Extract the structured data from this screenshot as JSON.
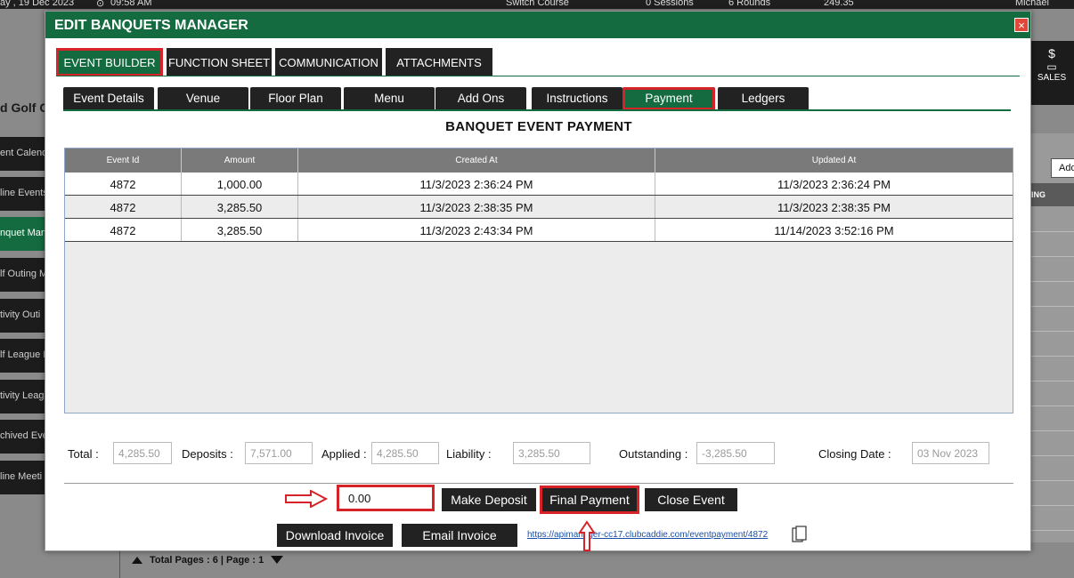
{
  "background": {
    "topbar": {
      "date": "ay , 19 Dec 2023",
      "time": "09:58 AM",
      "switch_course": "Switch Course",
      "sessions": "0 Sessions",
      "rounds": "6 Rounds",
      "amount": "249.35",
      "user": "Michael"
    },
    "page_title": "d Golf C",
    "sidebar": [
      {
        "label": "ent Calend",
        "active": false
      },
      {
        "label": "line Events",
        "active": false
      },
      {
        "label": "nquet Man",
        "active": true
      },
      {
        "label": "lf Outing M",
        "active": false
      },
      {
        "label": "tivity Outi",
        "active": false
      },
      {
        "label": "lf League N",
        "active": false
      },
      {
        "label": "tivity Leag",
        "active": false
      },
      {
        "label": "chived Eve",
        "active": false
      },
      {
        "label": "line Meeti",
        "active": false
      }
    ],
    "sales_label": "SALES",
    "add_label": "Add",
    "column_label": "ING",
    "pagination": "Total Pages : 6 | Page : 1"
  },
  "modal": {
    "title": "EDIT BANQUETS MANAGER",
    "close_glyph": "×",
    "main_tabs": [
      {
        "label": "EVENT BUILDER",
        "active": true
      },
      {
        "label": "FUNCTION SHEET",
        "active": false
      },
      {
        "label": "COMMUNICATION",
        "active": false
      },
      {
        "label": "ATTACHMENTS",
        "active": false
      }
    ],
    "sub_tabs": [
      {
        "label": "Event Details",
        "active": false
      },
      {
        "label": "Venue",
        "active": false
      },
      {
        "label": "Floor Plan",
        "active": false
      },
      {
        "label": "Menu",
        "active": false
      },
      {
        "label": "Add Ons",
        "active": false
      },
      {
        "label": "Instructions",
        "active": false
      },
      {
        "label": "Payment",
        "active": true
      },
      {
        "label": "Ledgers",
        "active": false
      }
    ],
    "section_title": "BANQUET EVENT PAYMENT",
    "table": {
      "columns": [
        "Event Id",
        "Amount",
        "Created At",
        "Updated At"
      ],
      "rows": [
        [
          "4872",
          "1,000.00",
          "11/3/2023 2:36:24 PM",
          "11/3/2023 2:36:24 PM"
        ],
        [
          "4872",
          "3,285.50",
          "11/3/2023 2:38:35 PM",
          "11/3/2023 2:38:35 PM"
        ],
        [
          "4872",
          "3,285.50",
          "11/3/2023 2:43:34 PM",
          "11/14/2023 3:52:16 PM"
        ]
      ]
    },
    "totals": {
      "total_label": "Total :",
      "total_value": "4,285.50",
      "deposits_label": "Deposits :",
      "deposits_value": "7,571.00",
      "applied_label": "Applied :",
      "applied_value": "4,285.50",
      "liability_label": "Liability :",
      "liability_value": "3,285.50",
      "outstanding_label": "Outstanding :",
      "outstanding_value": "-3,285.50",
      "closing_label": "Closing Date :",
      "closing_value": "03 Nov 2023"
    },
    "amount_input_value": "0.00",
    "buttons": {
      "make_deposit": "Make Deposit",
      "final_payment": "Final Payment",
      "close_event": "Close Event",
      "download_invoice": "Download Invoice",
      "email_invoice": "Email Invoice"
    },
    "payment_link": "https://apimanager-cc17.clubcaddie.com/eventpayment/4872"
  },
  "colors": {
    "brand_green": "#136b3f",
    "highlight_red": "#d6232a",
    "button_dark": "#222222",
    "link_blue": "#1a4fa8"
  }
}
